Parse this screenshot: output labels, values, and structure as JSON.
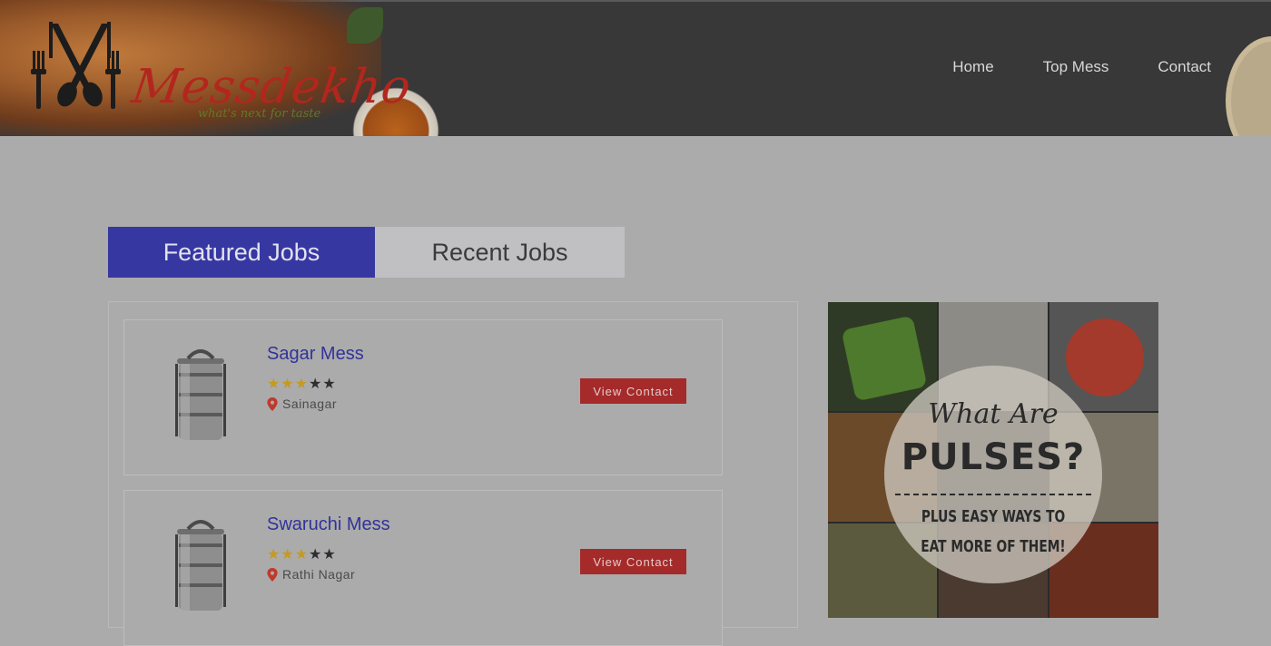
{
  "header": {
    "logo_text": "Messdekho",
    "logo_tagline": "what's next for taste",
    "nav": [
      "Home",
      "Top Mess",
      "Contact"
    ]
  },
  "tabs": [
    {
      "label": "Featured Jobs",
      "active": true
    },
    {
      "label": "Recent Jobs",
      "active": false
    }
  ],
  "listings": [
    {
      "name": "Sagar Mess",
      "rating": 3,
      "max_rating": 5,
      "location": "Sainagar",
      "button": "View Contact"
    },
    {
      "name": "Swaruchi Mess",
      "rating": 3,
      "max_rating": 5,
      "location": "Rathi Nagar",
      "button": "View Contact"
    }
  ],
  "ad": {
    "line1": "What Are",
    "line2": "PULSES?",
    "line3": "Plus easy ways to",
    "line4": "eat more of them!"
  },
  "colors": {
    "overlay_bg": "#ababab",
    "header_bg": "#383838",
    "tab_active": "#3737a2",
    "tab_inactive": "#c0c0c3",
    "mess_name": "#32329a",
    "button_bg": "#a52a2a",
    "star_on": "#c49a21",
    "location_pin": "#c0392b"
  }
}
